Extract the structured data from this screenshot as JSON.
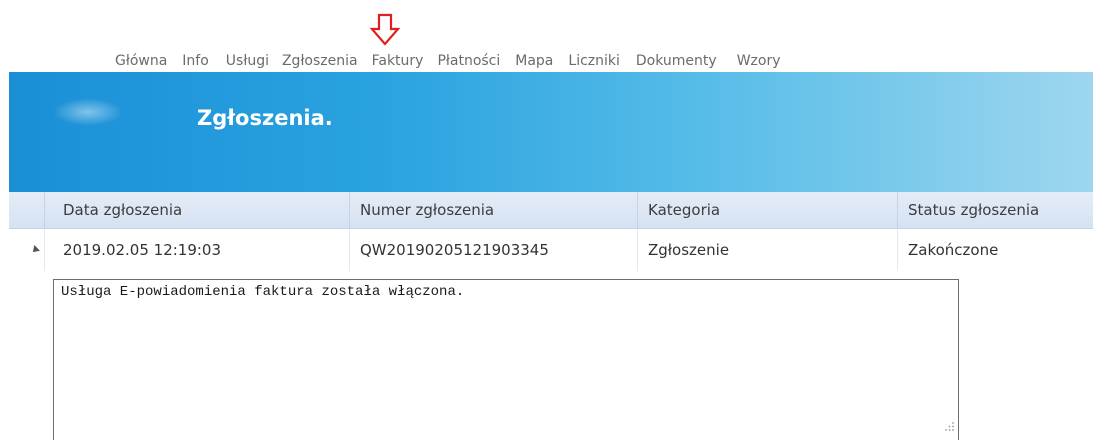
{
  "nav": {
    "items": [
      {
        "label": "Główna"
      },
      {
        "label": "Info"
      },
      {
        "label": "Usługi"
      },
      {
        "label": "Zgłoszenia"
      },
      {
        "label": "Faktury"
      },
      {
        "label": "Płatności"
      },
      {
        "label": "Mapa"
      },
      {
        "label": "Liczniki"
      },
      {
        "label": "Dokumenty"
      },
      {
        "label": "Wzory"
      }
    ],
    "highlight_arrow_color": "#e02020"
  },
  "banner": {
    "title": "Zgłoszenia.",
    "gradient_start": "#1b8fd6",
    "gradient_end": "#9ed6ef"
  },
  "table": {
    "columns": [
      "Data zgłoszenia",
      "Numer zgłoszenia",
      "Kategoria",
      "Status zgłoszenia"
    ],
    "rows": [
      {
        "date": "2019.02.05 12:19:03",
        "number": "QW20190205121903345",
        "category": "Zgłoszenie",
        "status": "Zakończone",
        "expanded": true
      }
    ]
  },
  "detail": {
    "text": "Usługa E-powiadomienia faktura została włączona."
  }
}
